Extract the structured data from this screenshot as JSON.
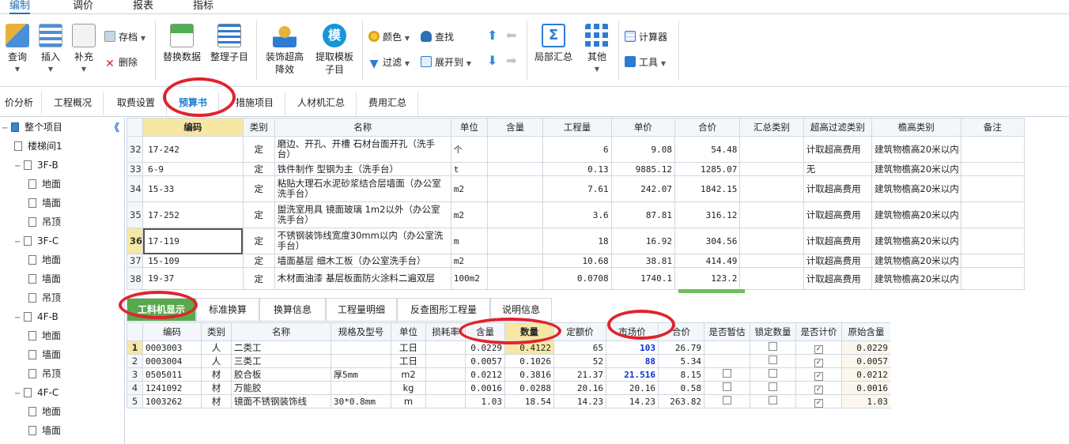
{
  "menu_tabs": [
    "编制",
    "调价",
    "报表",
    "指标"
  ],
  "ribbon": {
    "query": "查询",
    "insert": "插入",
    "supplement": "补充",
    "archive": "存档",
    "delete": "删除",
    "replace_sub": "替换数据",
    "tidy_sub": "整理子目",
    "decor_line1": "装饰超高",
    "decor_line2": "降效",
    "template_line1": "提取模板",
    "template_line2": "子目",
    "template_glyph": "模",
    "color": "颜色",
    "find": "查找",
    "filter": "过滤",
    "expand": "展开到",
    "local_summary": "局部汇总",
    "other": "其他",
    "calculator": "计算器",
    "tools": "工具"
  },
  "page_tabs": [
    "价分析",
    "工程概况",
    "取费设置",
    "预算书",
    "措施项目",
    "人材机汇总",
    "费用汇总"
  ],
  "tree": {
    "collapse_glyph": "《",
    "items": [
      {
        "label": "整个项目",
        "level": 0,
        "expander": "−"
      },
      {
        "label": "楼梯间1",
        "level": 1
      },
      {
        "label": "3F-B",
        "level": 1,
        "expander": "−"
      },
      {
        "label": "地面",
        "level": 2
      },
      {
        "label": "墙面",
        "level": 2
      },
      {
        "label": "吊顶",
        "level": 2
      },
      {
        "label": "3F-C",
        "level": 1,
        "expander": "−"
      },
      {
        "label": "地面",
        "level": 2
      },
      {
        "label": "墙面",
        "level": 2
      },
      {
        "label": "吊顶",
        "level": 2
      },
      {
        "label": "4F-B",
        "level": 1,
        "expander": "−"
      },
      {
        "label": "地面",
        "level": 2
      },
      {
        "label": "墙面",
        "level": 2
      },
      {
        "label": "吊顶",
        "level": 2
      },
      {
        "label": "4F-C",
        "level": 1,
        "expander": "−"
      },
      {
        "label": "地面",
        "level": 2
      },
      {
        "label": "墙面",
        "level": 2
      }
    ]
  },
  "main_grid": {
    "headers": [
      "编码",
      "类别",
      "名称",
      "单位",
      "含量",
      "工程量",
      "单价",
      "合价",
      "汇总类别",
      "超高过滤类别",
      "檐高类别",
      "备注"
    ],
    "rows": [
      {
        "n": "32",
        "code": "17-242",
        "type": "定",
        "name": "磨边、开孔、开槽 石材台面开孔（洗手台）",
        "unit": "个",
        "content": "",
        "qty": "6",
        "price": "9.08",
        "total": "54.48",
        "sum": "",
        "filter": "计取超高费用",
        "eave": "建筑物檐高20米以内",
        "note": ""
      },
      {
        "n": "33",
        "code": "6-9",
        "type": "定",
        "name": "铁件制作 型钢为主（洗手台）",
        "unit": "t",
        "content": "",
        "qty": "0.13",
        "price": "9885.12",
        "total": "1285.07",
        "sum": "",
        "filter": "无",
        "eave": "建筑物檐高20米以内",
        "note": ""
      },
      {
        "n": "34",
        "code": "15-33",
        "type": "定",
        "name": "粘贴大理石水泥砂浆结合层墙面（办公室洗手台）",
        "unit": "m2",
        "content": "",
        "qty": "7.61",
        "price": "242.07",
        "total": "1842.15",
        "sum": "",
        "filter": "计取超高费用",
        "eave": "建筑物檐高20米以内",
        "note": ""
      },
      {
        "n": "35",
        "code": "17-252",
        "type": "定",
        "name": "盥洗室用具 镜面玻璃 1m2以外（办公室洗手台）",
        "unit": "m2",
        "content": "",
        "qty": "3.6",
        "price": "87.81",
        "total": "316.12",
        "sum": "",
        "filter": "计取超高费用",
        "eave": "建筑物檐高20米以内",
        "note": ""
      },
      {
        "n": "36",
        "code": "17-119",
        "type": "定",
        "name": "不锈钢装饰线宽度30mm以内（办公室洗手台）",
        "unit": "m",
        "content": "",
        "qty": "18",
        "price": "16.92",
        "total": "304.56",
        "sum": "",
        "filter": "计取超高费用",
        "eave": "建筑物檐高20米以内",
        "note": ""
      },
      {
        "n": "37",
        "code": "15-109",
        "type": "定",
        "name": "墙面基层 细木工板（办公室洗手台）",
        "unit": "m2",
        "content": "",
        "qty": "10.68",
        "price": "38.81",
        "total": "414.49",
        "sum": "",
        "filter": "计取超高费用",
        "eave": "建筑物檐高20米以内",
        "note": ""
      },
      {
        "n": "38",
        "code": "19-37",
        "type": "定",
        "name": "木材面油漆 基层板面防火涂料二遍双层",
        "unit": "100m2",
        "content": "",
        "qty": "0.0708",
        "price": "1740.1",
        "total": "123.2",
        "sum": "",
        "filter": "计取超高费用",
        "eave": "建筑物檐高20米以内",
        "note": ""
      }
    ]
  },
  "bottom_tabs": [
    "工料机显示",
    "标准换算",
    "换算信息",
    "工程量明细",
    "反查图形工程量",
    "说明信息"
  ],
  "sub_grid": {
    "headers": [
      "编码",
      "类别",
      "名称",
      "规格及型号",
      "单位",
      "损耗率",
      "含量",
      "数量",
      "定额价",
      "市场价",
      "合价",
      "是否暂估",
      "锁定数量",
      "是否计价",
      "原始含量"
    ],
    "rows": [
      {
        "n": "1",
        "code": "0003003",
        "type": "人",
        "name": "二类工",
        "spec": "",
        "unit": "工日",
        "loss": "",
        "content": "0.0229",
        "qty": "0.4122",
        "quota": "65",
        "market": "103",
        "total": "26.79",
        "est": false,
        "lock": false,
        "priced": true,
        "orig": "0.0229"
      },
      {
        "n": "2",
        "code": "0003004",
        "type": "人",
        "name": "三类工",
        "spec": "",
        "unit": "工日",
        "loss": "",
        "content": "0.0057",
        "qty": "0.1026",
        "quota": "52",
        "market": "88",
        "total": "5.34",
        "est": false,
        "lock": false,
        "priced": true,
        "orig": "0.0057"
      },
      {
        "n": "3",
        "code": "0505011",
        "type": "材",
        "name": "胶合板",
        "spec": "厚5mm",
        "unit": "m2",
        "loss": "",
        "content": "0.0212",
        "qty": "0.3816",
        "quota": "21.37",
        "market": "21.516",
        "total": "8.15",
        "est": false,
        "lock": false,
        "priced": true,
        "orig": "0.0212"
      },
      {
        "n": "4",
        "code": "1241092",
        "type": "材",
        "name": "万能胶",
        "spec": "",
        "unit": "kg",
        "loss": "",
        "content": "0.0016",
        "qty": "0.0288",
        "quota": "20.16",
        "market": "20.16",
        "total": "0.58",
        "est": false,
        "lock": false,
        "priced": true,
        "orig": "0.0016"
      },
      {
        "n": "5",
        "code": "1003262",
        "type": "材",
        "name": "镜面不锈钢装饰线",
        "spec": "30*0.8mm",
        "unit": "m",
        "loss": "",
        "content": "1.03",
        "qty": "18.54",
        "quota": "14.23",
        "market": "14.23",
        "total": "263.82",
        "est": false,
        "lock": false,
        "priced": true,
        "orig": "1.03"
      }
    ],
    "blue_market_rows": [
      0,
      1,
      2
    ]
  },
  "check_glyph": "✓",
  "colors": {
    "accent": "#1f6fbf",
    "highlight_header": "#f7e7a4",
    "active_bottom_tab": "#5aa84c",
    "annotation": "#e0232d",
    "market_price_blue": "#0b2fd4"
  }
}
